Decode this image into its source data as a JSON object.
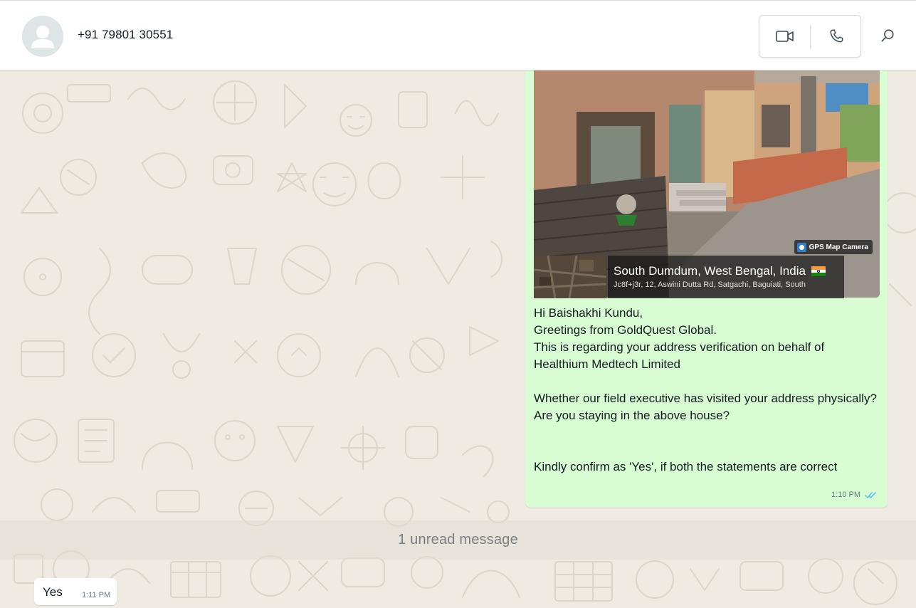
{
  "header": {
    "contact_name": "+91 79801 30551"
  },
  "photo": {
    "gps_badge": "GPS Map Camera",
    "place": "South Dumdum, West Bengal, India",
    "address": "Jc8f+j3r, 12, Aswini Dutta Rd, Satgachi, Baguiati, South"
  },
  "outgoing": {
    "text": "Hi Baishakhi Kundu,\nGreetings from GoldQuest Global.\nThis is regarding your address verification on behalf of Healthium Medtech Limited\n\nWhether our field executive has visited your address physically?\nAre you staying in the above house?\n\n\nKindly confirm as 'Yes', if both the statements are correct",
    "time": "1:10 PM"
  },
  "unread": {
    "label": "1 unread message"
  },
  "incoming": {
    "text": "Yes",
    "time": "1:11 PM"
  },
  "colors": {
    "outgoing_bubble": "#d9fdd3",
    "incoming_bubble": "#ffffff",
    "chat_background": "#efeae2",
    "read_ticks": "#53bdeb"
  }
}
